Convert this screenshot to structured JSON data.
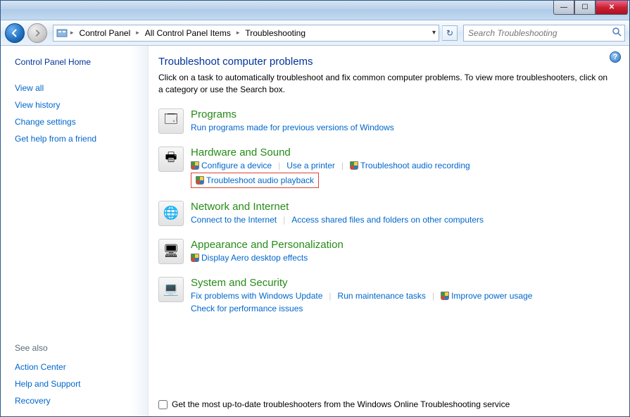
{
  "window": {
    "controls": {
      "min": "—",
      "max": "☐",
      "close": "✕"
    }
  },
  "toolbar": {
    "breadcrumbs": [
      "Control Panel",
      "All Control Panel Items",
      "Troubleshooting"
    ],
    "dropdown": "▾",
    "refresh": "↻",
    "search_placeholder": "Search Troubleshooting"
  },
  "sidebar": {
    "home": "Control Panel Home",
    "links": [
      "View all",
      "View history",
      "Change settings",
      "Get help from a friend"
    ],
    "see_also_label": "See also",
    "see_also": [
      "Action Center",
      "Help and Support",
      "Recovery"
    ]
  },
  "page": {
    "title": "Troubleshoot computer problems",
    "desc": "Click on a task to automatically troubleshoot and fix common computer problems. To view more troubleshooters, click on a category or use the Search box.",
    "help": "?"
  },
  "categories": [
    {
      "title": "Programs",
      "icon": "🗔",
      "tasks": [
        {
          "label": "Run programs made for previous versions of Windows",
          "shield": false
        }
      ]
    },
    {
      "title": "Hardware and Sound",
      "icon": "🖶",
      "tasks": [
        {
          "label": "Configure a device",
          "shield": true
        },
        {
          "label": "Use a printer",
          "shield": false
        },
        {
          "label": "Troubleshoot audio recording",
          "shield": true
        },
        {
          "label": "Troubleshoot audio playback",
          "shield": true,
          "highlighted": true,
          "newline": true
        }
      ]
    },
    {
      "title": "Network and Internet",
      "icon": "🌐",
      "tasks": [
        {
          "label": "Connect to the Internet",
          "shield": false
        },
        {
          "label": "Access shared files and folders on other computers",
          "shield": false
        }
      ]
    },
    {
      "title": "Appearance and Personalization",
      "icon": "🖥",
      "tasks": [
        {
          "label": "Display Aero desktop effects",
          "shield": true
        }
      ]
    },
    {
      "title": "System and Security",
      "icon": "💻",
      "tasks": [
        {
          "label": "Fix problems with Windows Update",
          "shield": false
        },
        {
          "label": "Run maintenance tasks",
          "shield": false
        },
        {
          "label": "Improve power usage",
          "shield": true
        },
        {
          "label": "Check for performance issues",
          "shield": false,
          "newline": true
        }
      ]
    }
  ],
  "footer": {
    "checkbox_label": "Get the most up-to-date troubleshooters from the Windows Online Troubleshooting service"
  }
}
